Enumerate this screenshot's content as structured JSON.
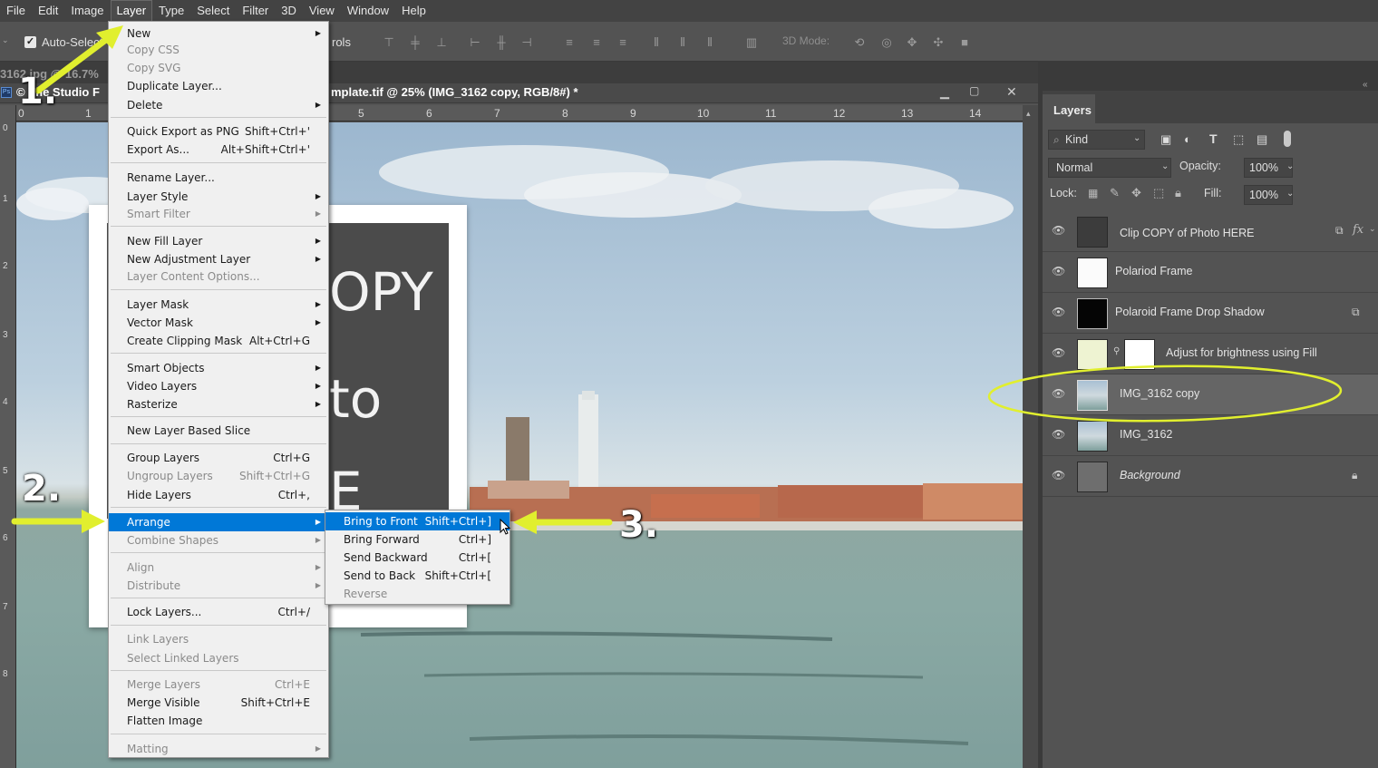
{
  "menubar": [
    "File",
    "Edit",
    "Image",
    "Layer",
    "Type",
    "Select",
    "Filter",
    "3D",
    "View",
    "Window",
    "Help"
  ],
  "options": {
    "auto_select_label": "Auto-Select",
    "controls_label": "rols",
    "mode_3d_label": "3D Mode:"
  },
  "doc": {
    "left_tab": "3162.jpg @ 16.7%",
    "studio_label": "© The Studio F",
    "title": "mplate.tif @ 25% (IMG_3162 copy, RGB/8#) *"
  },
  "ruler": [
    "0",
    "1",
    "5",
    "6",
    "7",
    "8",
    "9",
    "10",
    "11",
    "12",
    "13",
    "14"
  ],
  "ruler_v": [
    "0",
    "1",
    "2",
    "3",
    "4",
    "5",
    "6",
    "7",
    "8"
  ],
  "canvas_text": {
    "copy_fragment": "OPY",
    "photo_fragment": "to",
    "e_fragment": "E"
  },
  "layer_menu": [
    {
      "label": "New",
      "sub": true
    },
    {
      "label": "Copy CSS",
      "disabled": true
    },
    {
      "label": "Copy SVG",
      "disabled": true
    },
    {
      "label": "Duplicate Layer..."
    },
    {
      "label": "Delete",
      "sub": true
    },
    {
      "label": "Quick Export as PNG",
      "shortcut": "Shift+Ctrl+'"
    },
    {
      "label": "Export As...",
      "shortcut": "Alt+Shift+Ctrl+'"
    },
    {
      "label": "Rename Layer..."
    },
    {
      "label": "Layer Style",
      "sub": true
    },
    {
      "label": "Smart Filter",
      "sub": true,
      "disabled": true
    },
    {
      "label": "New Fill Layer",
      "sub": true
    },
    {
      "label": "New Adjustment Layer",
      "sub": true
    },
    {
      "label": "Layer Content Options...",
      "disabled": true
    },
    {
      "label": "Layer Mask",
      "sub": true
    },
    {
      "label": "Vector Mask",
      "sub": true
    },
    {
      "label": "Create Clipping Mask",
      "shortcut": "Alt+Ctrl+G"
    },
    {
      "label": "Smart Objects",
      "sub": true
    },
    {
      "label": "Video Layers",
      "sub": true
    },
    {
      "label": "Rasterize",
      "sub": true
    },
    {
      "label": "New Layer Based Slice"
    },
    {
      "label": "Group Layers",
      "shortcut": "Ctrl+G"
    },
    {
      "label": "Ungroup Layers",
      "shortcut": "Shift+Ctrl+G",
      "disabled": true
    },
    {
      "label": "Hide Layers",
      "shortcut": "Ctrl+,"
    },
    {
      "label": "Arrange",
      "sub": true,
      "highlighted": true
    },
    {
      "label": "Combine Shapes",
      "sub": true,
      "disabled": true
    },
    {
      "label": "Align",
      "sub": true,
      "disabled": true
    },
    {
      "label": "Distribute",
      "sub": true,
      "disabled": true
    },
    {
      "label": "Lock Layers...",
      "shortcut": "Ctrl+/"
    },
    {
      "label": "Link Layers",
      "disabled": true
    },
    {
      "label": "Select Linked Layers",
      "disabled": true
    },
    {
      "label": "Merge Layers",
      "shortcut": "Ctrl+E",
      "disabled": true
    },
    {
      "label": "Merge Visible",
      "shortcut": "Shift+Ctrl+E"
    },
    {
      "label": "Flatten Image"
    },
    {
      "label": "Matting",
      "sub": true,
      "disabled": true
    }
  ],
  "arrange_menu": [
    {
      "label": "Bring to Front",
      "shortcut": "Shift+Ctrl+]",
      "highlighted": true
    },
    {
      "label": "Bring Forward",
      "shortcut": "Ctrl+]"
    },
    {
      "label": "Send Backward",
      "shortcut": "Ctrl+["
    },
    {
      "label": "Send to Back",
      "shortcut": "Shift+Ctrl+["
    },
    {
      "label": "Reverse",
      "disabled": true
    }
  ],
  "layers_panel": {
    "title": "Layers",
    "kind_label": "Kind",
    "blend_mode": "Normal",
    "opacity_label": "Opacity:",
    "opacity_value": "100%",
    "lock_label": "Lock:",
    "fill_label": "Fill:",
    "fill_value": "100%",
    "fx_label": "fx",
    "layers": [
      {
        "name": "Clip COPY of Photo HERE",
        "italic": false
      },
      {
        "name": "Polariod Frame",
        "italic": false
      },
      {
        "name": "Polaroid Frame Drop Shadow",
        "italic": false
      },
      {
        "name": "Adjust for brightness using Fill",
        "italic": false
      },
      {
        "name": "IMG_3162 copy",
        "italic": false,
        "selected": true
      },
      {
        "name": "IMG_3162",
        "italic": false
      },
      {
        "name": "Background",
        "italic": true
      }
    ]
  },
  "annotations": {
    "step1": "1.",
    "step2": "2.",
    "step3": "3."
  },
  "colors": {
    "annotation": "#e1ef2e",
    "menu_highlight": "#0078d7"
  }
}
